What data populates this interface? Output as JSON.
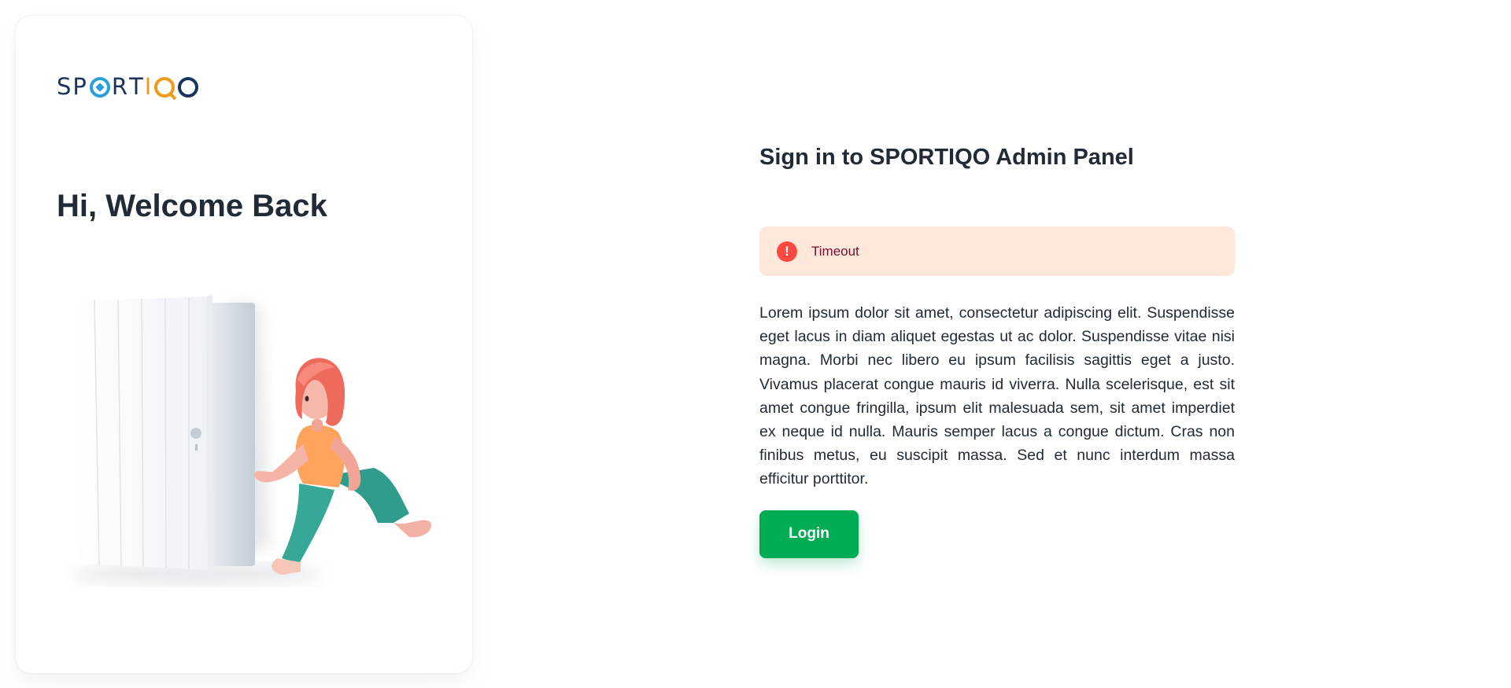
{
  "brand": {
    "logo_text": "SPORTIQO"
  },
  "left_panel": {
    "welcome": "Hi, Welcome Back"
  },
  "signin": {
    "title": "Sign in to SPORTIQO Admin Panel",
    "alert": {
      "icon": "error-icon",
      "icon_glyph": "!",
      "message": "Timeout"
    },
    "description": "Lorem ipsum dolor sit amet, consectetur adipiscing elit. Suspendisse eget lacus in diam aliquet egestas ut ac dolor. Suspendisse vitae nisi magna. Morbi nec libero eu ipsum facilisis sagittis eget a justo. Vivamus placerat congue mauris id viverra. Nulla scelerisque, est sit amet congue fringilla, ipsum elit malesuada sem, sit amet imperdiet ex neque id nulla. Mauris semper lacus a congue dictum. Cras non finibus metus, eu suscipit massa. Sed et nunc interdum massa efficitur porttitor.",
    "login_label": "Login"
  },
  "colors": {
    "primary": "#00ab55",
    "error": "#ff4842",
    "alert_bg": "#ffe7d9",
    "text": "#212b36",
    "brand_navy": "#17355e",
    "brand_blue": "#2a9fd8",
    "brand_orange": "#f09a1a"
  }
}
